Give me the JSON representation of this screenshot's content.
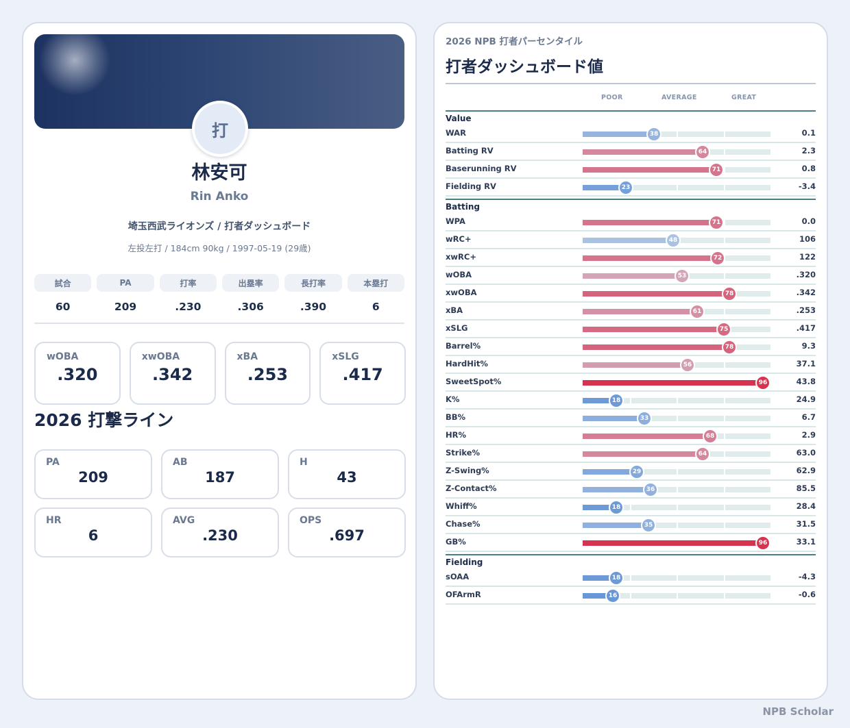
{
  "player": {
    "avatar_char": "打",
    "name": "林安可",
    "roman": "Rin Anko",
    "team_line": "埼玉西武ライオンズ / 打者ダッシュボード",
    "bio_line": "左投左打 / 184cm 90kg / 1997-05-19 (29歳)"
  },
  "summary_stats": [
    {
      "label": "試合",
      "value": "60"
    },
    {
      "label": "PA",
      "value": "209"
    },
    {
      "label": "打率",
      "value": ".230"
    },
    {
      "label": "出塁率",
      "value": ".306"
    },
    {
      "label": "長打率",
      "value": ".390"
    },
    {
      "label": "本塁打",
      "value": "6"
    }
  ],
  "expected_stats": [
    {
      "label": "wOBA",
      "value": ".320"
    },
    {
      "label": "xwOBA",
      "value": ".342"
    },
    {
      "label": "xBA",
      "value": ".253"
    },
    {
      "label": "xSLG",
      "value": ".417"
    }
  ],
  "batting_line": {
    "title": "2026 打撃ライン",
    "items": [
      {
        "label": "PA",
        "value": "209"
      },
      {
        "label": "AB",
        "value": "187"
      },
      {
        "label": "H",
        "value": "43"
      },
      {
        "label": "HR",
        "value": "6"
      },
      {
        "label": "AVG",
        "value": ".230"
      },
      {
        "label": "OPS",
        "value": ".697"
      }
    ]
  },
  "percentiles": {
    "subtitle": "2026 NPB 打者パーセンタイル",
    "title": "打者ダッシュボード値",
    "scale": {
      "poor": "POOR",
      "average": "AVERAGE",
      "great": "GREAT"
    },
    "groups": [
      {
        "name": "Value",
        "rows": [
          {
            "label": "WAR",
            "pct": 38,
            "value": "0.1"
          },
          {
            "label": "Batting RV",
            "pct": 64,
            "value": "2.3"
          },
          {
            "label": "Baserunning RV",
            "pct": 71,
            "value": "0.8"
          },
          {
            "label": "Fielding RV",
            "pct": 23,
            "value": "-3.4"
          }
        ]
      },
      {
        "name": "Batting",
        "rows": [
          {
            "label": "WPA",
            "pct": 71,
            "value": "0.0"
          },
          {
            "label": "wRC+",
            "pct": 48,
            "value": "106"
          },
          {
            "label": "xwRC+",
            "pct": 72,
            "value": "122"
          },
          {
            "label": "wOBA",
            "pct": 53,
            "value": ".320"
          },
          {
            "label": "xwOBA",
            "pct": 78,
            "value": ".342"
          },
          {
            "label": "xBA",
            "pct": 61,
            "value": ".253"
          },
          {
            "label": "xSLG",
            "pct": 75,
            "value": ".417"
          },
          {
            "label": "Barrel%",
            "pct": 78,
            "value": "9.3"
          },
          {
            "label": "HardHit%",
            "pct": 56,
            "value": "37.1"
          },
          {
            "label": "SweetSpot%",
            "pct": 96,
            "value": "43.8"
          },
          {
            "label": "K%",
            "pct": 18,
            "value": "24.9"
          },
          {
            "label": "BB%",
            "pct": 33,
            "value": "6.7"
          },
          {
            "label": "HR%",
            "pct": 68,
            "value": "2.9"
          },
          {
            "label": "Strike%",
            "pct": 64,
            "value": "63.0"
          },
          {
            "label": "Z-Swing%",
            "pct": 29,
            "value": "62.9"
          },
          {
            "label": "Z-Contact%",
            "pct": 36,
            "value": "85.5"
          },
          {
            "label": "Whiff%",
            "pct": 18,
            "value": "28.4"
          },
          {
            "label": "Chase%",
            "pct": 35,
            "value": "31.5"
          },
          {
            "label": "GB%",
            "pct": 96,
            "value": "33.1"
          }
        ]
      },
      {
        "name": "Fielding",
        "rows": [
          {
            "label": "sOAA",
            "pct": 18,
            "value": "-4.3"
          },
          {
            "label": "OFArmR",
            "pct": 16,
            "value": "-0.6"
          }
        ]
      }
    ]
  },
  "footer": "NPB Scholar"
}
